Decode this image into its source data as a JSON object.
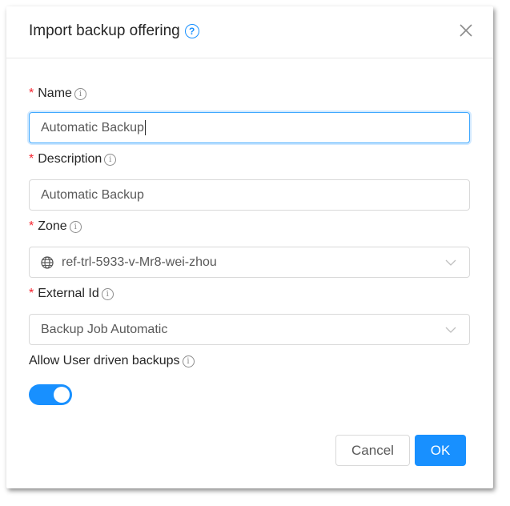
{
  "dialog": {
    "title": "Import backup offering",
    "help_icon": "question-circle-icon",
    "close_icon": "close-icon"
  },
  "form": {
    "name": {
      "required": "*",
      "label": "Name",
      "value": "Automatic Backup",
      "focused": true
    },
    "description": {
      "required": "*",
      "label": "Description",
      "value": "Automatic Backup"
    },
    "zone": {
      "required": "*",
      "label": "Zone",
      "value": "ref-trl-5933-v-Mr8-wei-zhou",
      "icon": "globe-icon"
    },
    "external_id": {
      "required": "*",
      "label": "External Id",
      "value": "Backup Job Automatic"
    },
    "allow_user_driven": {
      "label": "Allow User driven backups",
      "enabled": true
    }
  },
  "footer": {
    "cancel_label": "Cancel",
    "ok_label": "OK"
  },
  "colors": {
    "primary": "#1890ff",
    "required": "#f5222d"
  }
}
